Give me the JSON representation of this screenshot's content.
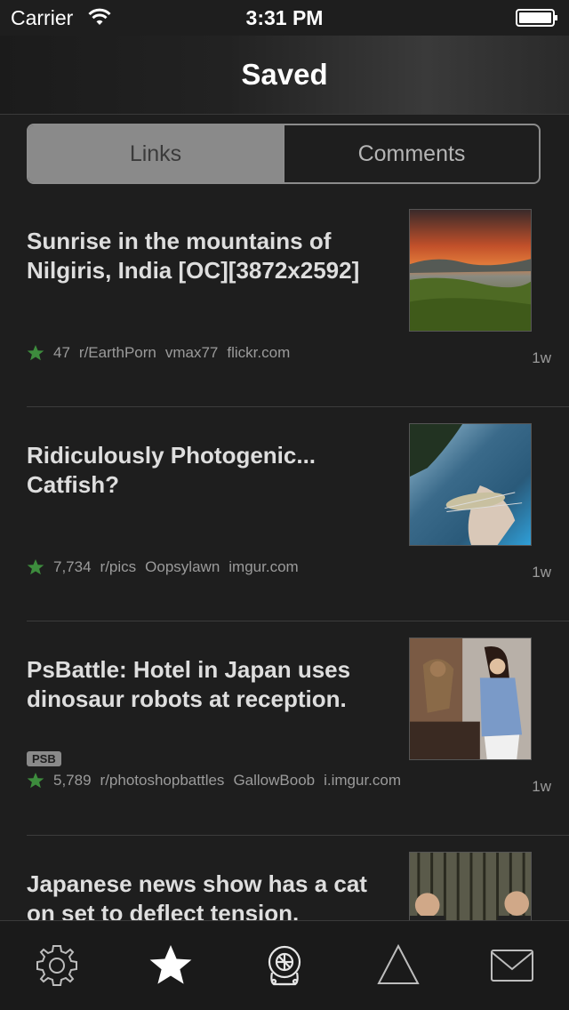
{
  "status_bar": {
    "carrier": "Carrier",
    "time": "3:31 PM"
  },
  "nav": {
    "title": "Saved"
  },
  "segments": {
    "links": "Links",
    "comments": "Comments",
    "selected": "links"
  },
  "posts": [
    {
      "title": "Sunrise in the mountains of Nilgiris, India [OC][3872x2592]",
      "score": "47",
      "subreddit": "r/EarthPorn",
      "author": "vmax77",
      "domain": "flickr.com",
      "age": "1w",
      "flair": "",
      "thumb": "sunrise-mountains"
    },
    {
      "title": "Ridiculously Photogenic... Catfish?",
      "score": "7,734",
      "subreddit": "r/pics",
      "author": "Oopsylawn",
      "domain": "imgur.com",
      "age": "1w",
      "flair": "",
      "thumb": "catfish"
    },
    {
      "title": "PsBattle: Hotel in Japan uses dinosaur robots at reception.",
      "score": "5,789",
      "subreddit": "r/photoshopbattles",
      "author": "GallowBoob",
      "domain": "i.imgur.com",
      "age": "1w",
      "flair": "PSB",
      "thumb": "dinosaur-hotel"
    },
    {
      "title": "Japanese news show has a cat on set to deflect tension.",
      "score": "",
      "subreddit": "",
      "author": "",
      "domain": "",
      "age": "",
      "flair": "",
      "thumb": "news-show"
    }
  ],
  "tabs": [
    {
      "icon": "settings-gear-icon",
      "active": false
    },
    {
      "icon": "star-icon",
      "active": true
    },
    {
      "icon": "diving-helmet-icon",
      "active": false
    },
    {
      "icon": "triangle-icon",
      "active": false
    },
    {
      "icon": "mail-envelope-icon",
      "active": false
    }
  ],
  "colors": {
    "background": "#1e1e1e",
    "star_green": "#3d8c3d",
    "meta_gray": "#9b9b9b",
    "segment_active": "#8a8a8a"
  }
}
